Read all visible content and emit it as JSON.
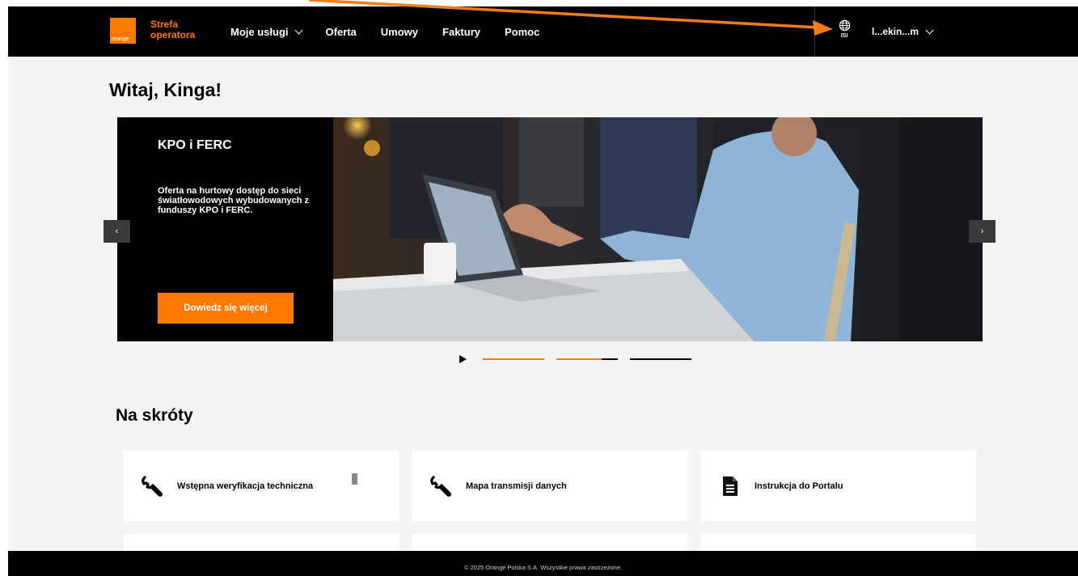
{
  "header": {
    "logo_text": "orange",
    "brand_line1": "Strefa",
    "brand_line2": "operatora",
    "nav": [
      {
        "label": "Moje usługi",
        "has_dropdown": true
      },
      {
        "label": "Oferta"
      },
      {
        "label": "Umowy"
      },
      {
        "label": "Faktury"
      },
      {
        "label": "Pomoc"
      }
    ],
    "language_code": "ISI",
    "user_name": "l...ekin...m"
  },
  "greeting": "Witaj, Kinga!",
  "banner": {
    "title": "KPO i FERC",
    "description": "Oferta na hurtowy dostęp do sieci światłowodowych wybudowanych z funduszy KPO i FERC.",
    "cta_label": "Dowiedz się więcej",
    "prev_label": "‹",
    "next_label": "›"
  },
  "carousel": {
    "slides": 3,
    "active_index": 1
  },
  "shortcuts": {
    "title": "Na skróty",
    "items": [
      {
        "label": "Wstępna weryfikacja techniczna",
        "icon": "wrench-icon"
      },
      {
        "label": "Mapa transmisji danych",
        "icon": "wrench-icon"
      },
      {
        "label": "Instrukcja do Portalu",
        "icon": "document-icon"
      }
    ]
  },
  "footer": {
    "copyright": "© 2025 Orange Polska S.A. Wszystkie prawa zastrzeżone."
  },
  "colors": {
    "brand_orange": "#ff7900",
    "header_bg": "#000000",
    "page_bg": "#f4f4f4"
  }
}
